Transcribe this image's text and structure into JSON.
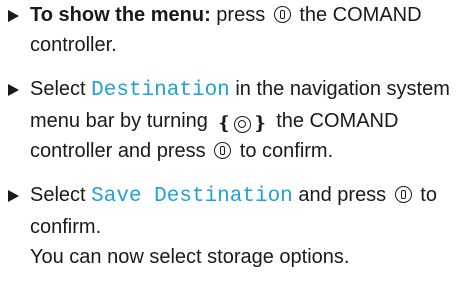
{
  "steps": [
    {
      "lead_bold": "To show the menu:",
      "t1": " press",
      "t2": " the COMAND controller."
    },
    {
      "t1": "Select ",
      "highlight": "Destination",
      "t2": " in the navigation system menu bar by turning",
      "t3": " the COMAND controller and press",
      "t4": " to confirm."
    },
    {
      "t1": "Select ",
      "highlight": "Save Destination",
      "t2": " and press",
      "t3": " to confirm.",
      "result": "You can now select storage options."
    }
  ],
  "icons": {
    "press": "controller-press-icon",
    "turn": "controller-turn-icon"
  },
  "colors": {
    "highlight": "#1ea2d8",
    "text": "#1a1a1a"
  }
}
